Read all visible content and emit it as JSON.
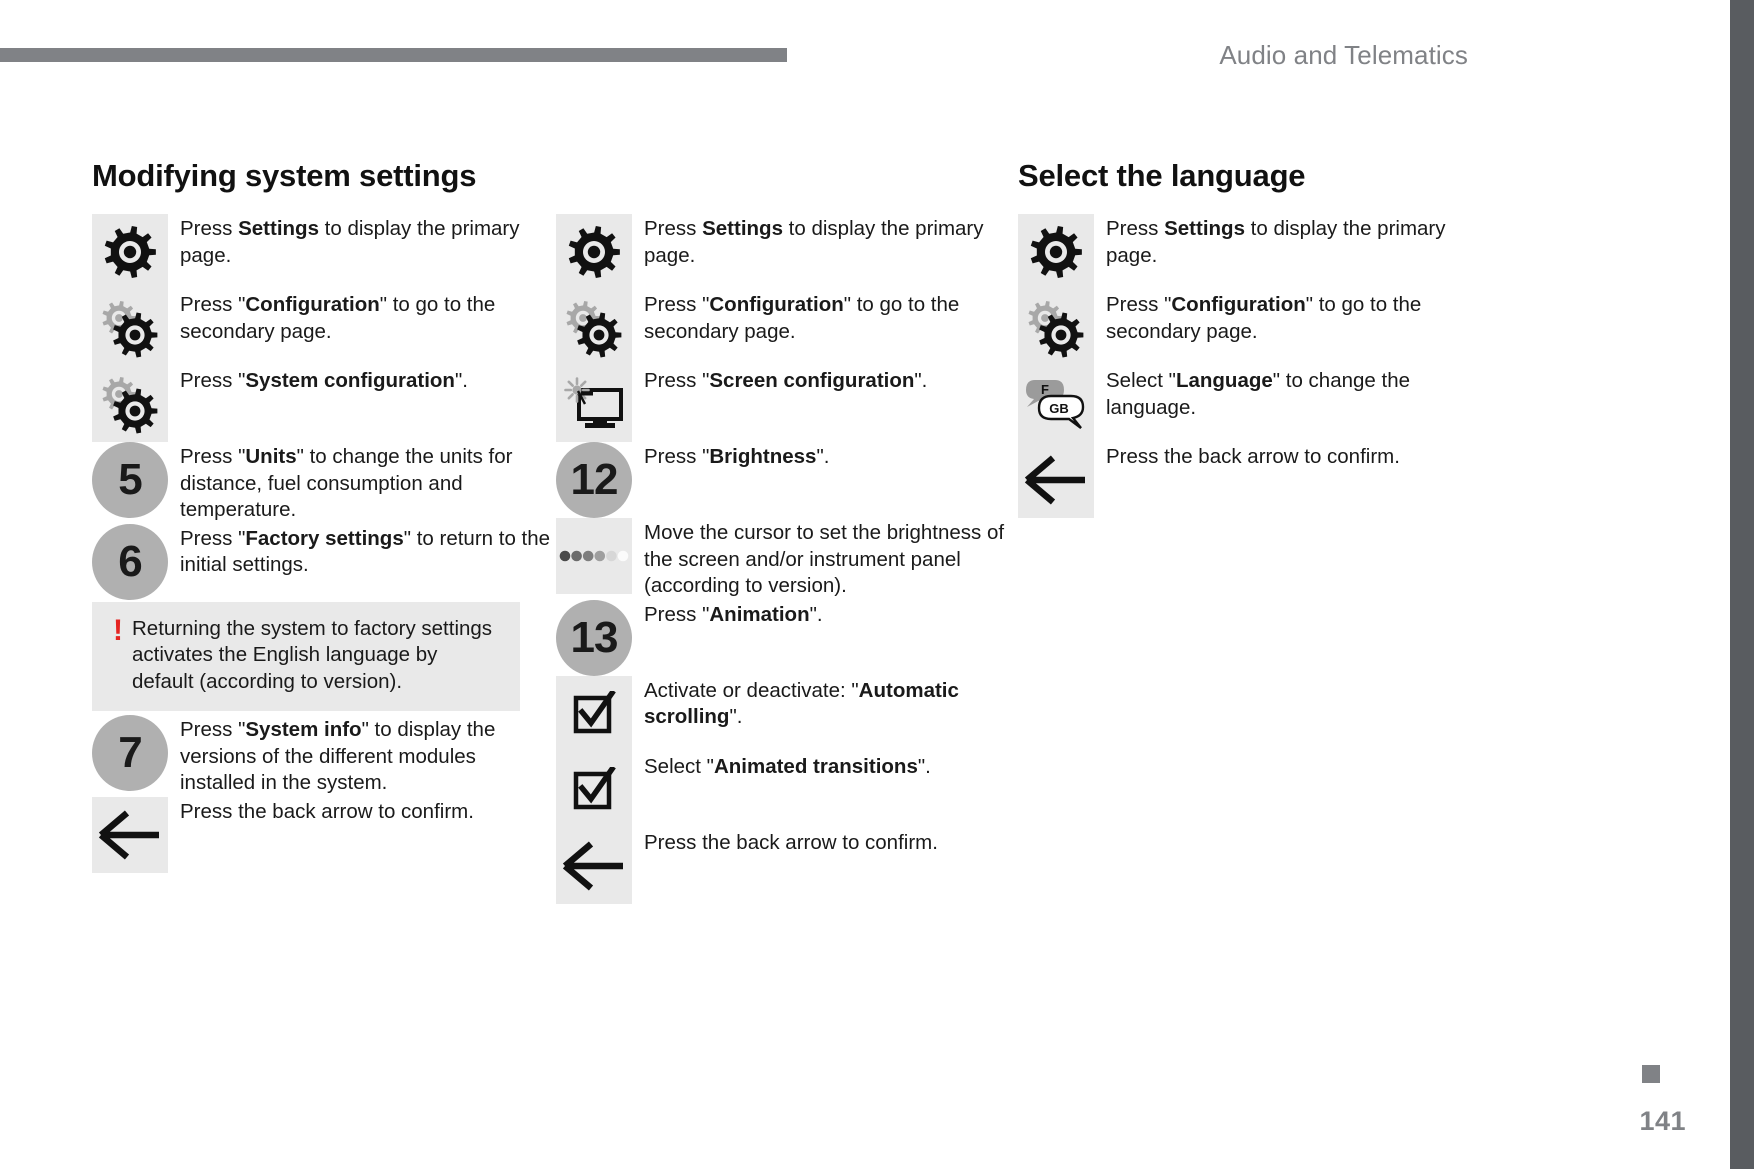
{
  "header": {
    "title": "Audio and Telematics"
  },
  "footer": {
    "page_number": "141"
  },
  "colors": {
    "accent_gray": "#808286",
    "edge_bar": "#595c60",
    "icon_bg": "#e9e9e9",
    "number_circle": "#b0b0b0",
    "warning_red": "#e52421"
  },
  "columns": [
    {
      "title": "Modifying system settings",
      "steps": [
        {
          "icon": "gear-icon",
          "text_html": "Press <b>Settings</b> to display the primary page."
        },
        {
          "icon": "double-gear-icon",
          "text_html": "Press \"<b>Configuration</b>\" to go to the secondary page."
        },
        {
          "icon": "double-gear-icon",
          "text_html": "Press \"<b>System configuration</b>\"."
        },
        {
          "icon": "number-circle",
          "number": "5",
          "text_html": "Press \"<b>Units</b>\" to change the units for distance, fuel consumption and temperature."
        },
        {
          "icon": "number-circle",
          "number": "6",
          "text_html": "Press \"<b>Factory settings</b>\" to return to the initial settings."
        },
        {
          "icon": "warning-box",
          "warning_symbol": "!",
          "text_html": "Returning the system to factory settings activates the English language by default (according to version)."
        },
        {
          "icon": "number-circle",
          "number": "7",
          "text_html": "Press \"<b>System info</b>\" to display the versions of the different modules installed in the system."
        },
        {
          "icon": "back-arrow-icon",
          "text_html": "Press the back arrow to confirm."
        }
      ]
    },
    {
      "title": "",
      "steps": [
        {
          "icon": "gear-icon",
          "text_html": "Press <b>Settings</b> to display the primary page."
        },
        {
          "icon": "double-gear-icon",
          "text_html": "Press \"<b>Configuration</b>\" to go to the secondary page."
        },
        {
          "icon": "screen-configuration-icon",
          "text_html": "Press \"<b>Screen configuration</b>\"."
        },
        {
          "icon": "number-circle",
          "number": "12",
          "text_html": "Press \"<b>Brightness</b>\"."
        },
        {
          "icon": "brightness-dots-icon",
          "text_html": "Move the cursor to set the brightness of the screen and/or instrument panel (according to version)."
        },
        {
          "icon": "number-circle",
          "number": "13",
          "text_html": "Press \"<b>Animation</b>\"."
        },
        {
          "icon": "checkbox-checked-icon",
          "text_html": "Activate or deactivate: \"<b>Automatic scrolling</b>\"."
        },
        {
          "icon": "checkbox-checked-icon",
          "text_html": "Select \"<b>Animated transitions</b>\"."
        },
        {
          "icon": "back-arrow-icon",
          "text_html": "Press the back arrow to confirm."
        }
      ]
    },
    {
      "title": "Select the language",
      "steps": [
        {
          "icon": "gear-icon",
          "text_html": "Press <b>Settings</b> to display the primary page."
        },
        {
          "icon": "double-gear-icon",
          "text_html": "Press \"<b>Configuration</b>\" to go to the secondary page."
        },
        {
          "icon": "language-bubbles-icon",
          "bubble_labels": [
            "F",
            "GB"
          ],
          "text_html": "Select \"<b>Language</b>\" to change the language."
        },
        {
          "icon": "back-arrow-icon",
          "text_html": "Press the back arrow to confirm."
        }
      ]
    }
  ]
}
